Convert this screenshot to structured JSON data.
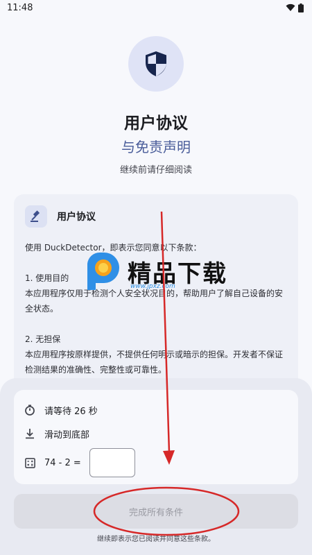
{
  "status_bar": {
    "time": "11:48",
    "wifi_icon": "wifi-icon",
    "battery_icon": "battery-icon"
  },
  "header": {
    "icon": "shield-icon",
    "title": "用户协议",
    "subtitle": "与免责声明",
    "caption": "继续前请仔细阅读"
  },
  "agreement": {
    "icon": "gavel-icon",
    "title": "用户协议",
    "intro": "使用 DuckDetector，即表示您同意以下条款：",
    "sections": [
      {
        "heading": "1. 使用目的",
        "text": "本应用程序仅用于检测个人安全状况目的，帮助用户了解自己设备的安全状态。"
      },
      {
        "heading": "2. 无担保",
        "text": "本应用程序按原样提供，不提供任何明示或暗示的担保。开发者不保证检测结果的准确性、完整性或可靠性。"
      }
    ]
  },
  "conditions": {
    "wait": {
      "icon": "timer-icon",
      "label": "请等待 26 秒"
    },
    "scroll": {
      "icon": "scroll-to-bottom-icon",
      "label": "滑动到底部"
    },
    "captcha": {
      "icon": "calculator-icon",
      "question": "74 - 2 =",
      "value": ""
    }
  },
  "finish_button": {
    "label": "完成所有条件"
  },
  "footer_note": "继续即表示您已阅读并同意这些条款。",
  "watermark": {
    "text": "精品下载",
    "url": "www.jpxz.com"
  },
  "colors": {
    "accent": "#4a5d9a",
    "annotation_red": "#d62828",
    "hero_bg": "#dfe3f6"
  }
}
